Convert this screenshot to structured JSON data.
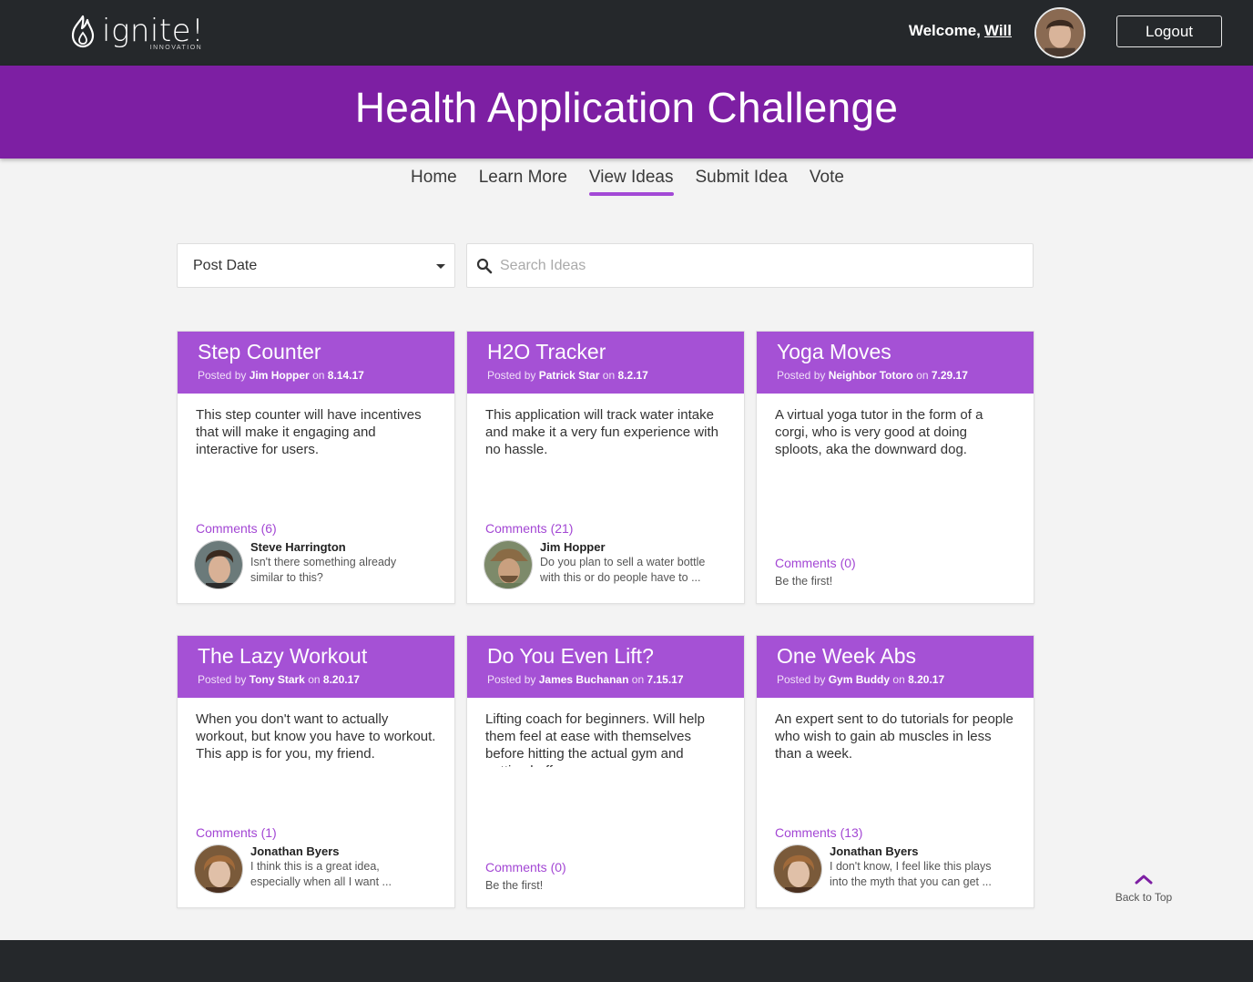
{
  "header": {
    "logo_text": "ignite!",
    "logo_sub": "INNOVATION",
    "welcome_label": "Welcome,",
    "user_name": "Will",
    "logout_label": "Logout"
  },
  "banner": {
    "title": "Health Application Challenge"
  },
  "nav": {
    "items": [
      {
        "label": "Home"
      },
      {
        "label": "Learn More"
      },
      {
        "label": "View Ideas"
      },
      {
        "label": "Submit Idea"
      },
      {
        "label": "Vote"
      }
    ],
    "active": "View Ideas"
  },
  "filters": {
    "sort_value": "Post Date",
    "search_placeholder": "Search Ideas"
  },
  "cards": [
    {
      "title": "Step Counter",
      "posted_by_label": "Posted by",
      "author": "Jim Hopper",
      "on_label": "on",
      "date": "8.14.17",
      "description": "This step counter will have incentives that will make it engaging and interactive for users.",
      "comments_label": "Comments (6)",
      "commenter": "Steve Harrington",
      "comment": "Isn't there something already similar to this?"
    },
    {
      "title": "H2O Tracker",
      "posted_by_label": "Posted by",
      "author": "Patrick Star",
      "on_label": "on",
      "date": "8.2.17",
      "description": "This application will track water intake and make it a very fun experience with no hassle.",
      "comments_label": "Comments (21)",
      "commenter": "Jim Hopper",
      "comment": "Do you plan to sell a water bottle with this or do people have to ..."
    },
    {
      "title": "Yoga Moves",
      "posted_by_label": "Posted by",
      "author": "Neighbor Totoro",
      "on_label": "on",
      "date": "7.29.17",
      "description": "A virtual yoga tutor in the form of a corgi, who is very good at doing sploots, aka the downward dog.",
      "comments_label": "Comments (0)",
      "empty_text": "Be the first!"
    },
    {
      "title": "The Lazy Workout",
      "posted_by_label": "Posted by",
      "author": "Tony Stark",
      "on_label": "on",
      "date": "8.20.17",
      "description": "When you don't want to actually workout, but know you have to workout. This app is for you, my friend.",
      "comments_label": "Comments (1)",
      "commenter": "Jonathan Byers",
      "comment": "I think this is a great idea, especially when all I want ..."
    },
    {
      "title": "Do You Even Lift?",
      "posted_by_label": "Posted by",
      "author": "James Buchanan",
      "on_label": "on",
      "date": "7.15.17",
      "description": "Lifting coach for beginners. Will help them feel at ease with themselves before hitting the actual gym and getting buff.",
      "comments_label": "Comments (0)",
      "empty_text": "Be the first!"
    },
    {
      "title": "One Week Abs",
      "posted_by_label": "Posted by",
      "author": "Gym Buddy",
      "on_label": "on",
      "date": "8.20.17",
      "description": "An expert sent to do tutorials for people who wish to gain ab muscles in less than a week.",
      "comments_label": "Comments (13)",
      "commenter": "Jonathan Byers",
      "comment": "I don't know, I feel like this plays into the myth that you can get ..."
    }
  ],
  "back_to_top": {
    "label": "Back to Top"
  },
  "colors": {
    "topbar": "#25282b",
    "banner": "#7d1fa3",
    "card_header": "#a551d5",
    "accent": "#a347d4"
  },
  "icons": [
    "flame-icon",
    "search-icon",
    "caret-down-icon",
    "chevron-up-icon"
  ]
}
